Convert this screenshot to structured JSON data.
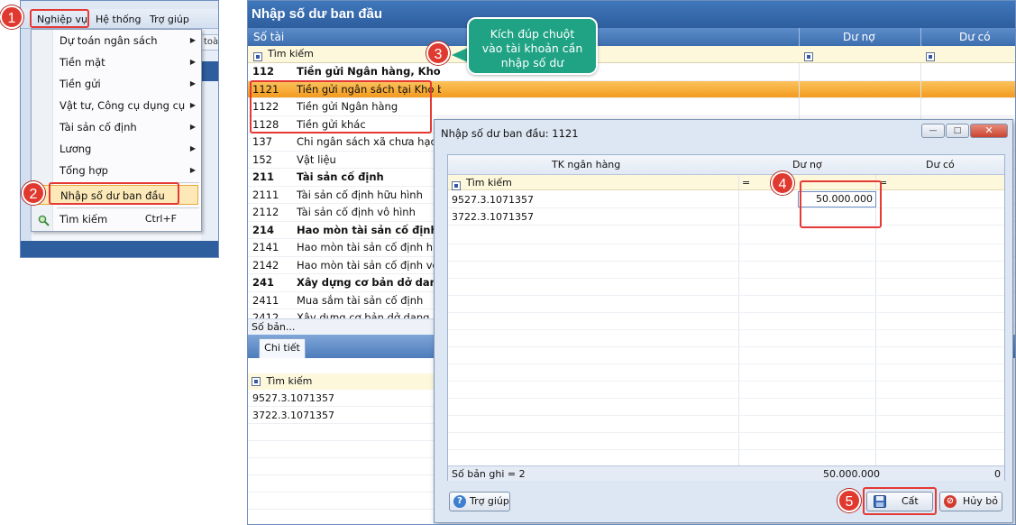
{
  "menu": {
    "menubar": [
      "Nghiệp vụ",
      "Hệ thống",
      "Trợ giúp"
    ],
    "items": [
      {
        "label": "Dự toán ngân sách",
        "submenu": true
      },
      {
        "label": "Tiền mặt",
        "submenu": true
      },
      {
        "label": "Tiền gửi",
        "submenu": true
      },
      {
        "label": "Vật tư, Công cụ dụng cụ",
        "submenu": true
      },
      {
        "label": "Tài sản cố định",
        "submenu": true
      },
      {
        "label": "Lương",
        "submenu": true
      },
      {
        "label": "Tổng hợp",
        "submenu": true
      },
      {
        "label": "Nhập số dư ban đầu",
        "submenu": false
      },
      {
        "label": "Tìm kiếm",
        "shortcut": "Ctrl+F",
        "submenu": false
      }
    ],
    "right_tab_fragment": "toà"
  },
  "steps": [
    "1",
    "2",
    "3",
    "4",
    "5"
  ],
  "main": {
    "title": "Nhập số dư ban đầu",
    "columns": {
      "account": "Số tài",
      "debit": "Dư nợ",
      "credit": "Dư có"
    },
    "search_label": "Tìm kiếm",
    "accounts": [
      {
        "code": "112",
        "name": "Tiền gửi Ngân hàng, Kho bạc",
        "bold": true
      },
      {
        "code": "1121",
        "name": "Tiền gửi ngân sách tại Kho bạc",
        "selected": true
      },
      {
        "code": "1122",
        "name": "Tiền gửi Ngân hàng"
      },
      {
        "code": "1128",
        "name": "Tiền gửi khác"
      },
      {
        "code": "137",
        "name": "Chi ngân sách xã chưa hạch toán"
      },
      {
        "code": "152",
        "name": "Vật liệu"
      },
      {
        "code": "211",
        "name": "Tài sản cố định",
        "bold": true
      },
      {
        "code": "2111",
        "name": "Tài sản cố định hữu hình"
      },
      {
        "code": "2112",
        "name": "Tài sản cố định vô hình"
      },
      {
        "code": "214",
        "name": "Hao mòn tài sản cố định",
        "bold": true
      },
      {
        "code": "2141",
        "name": "Hao mòn tài sản cố định hữu hình"
      },
      {
        "code": "2142",
        "name": "Hao mòn tài sản cố định vô hình"
      },
      {
        "code": "241",
        "name": "Xây dựng cơ bản dở dang",
        "bold": true
      },
      {
        "code": "2411",
        "name": "Mua sắm tài sản cố định"
      },
      {
        "code": "2412",
        "name": "Xây dựng cơ bản dở dang"
      }
    ],
    "footer": "Số bản...",
    "detail_tab": "Chi tiết",
    "detail_search": "Tìm kiếm",
    "detail_rows": [
      "9527.3.1071357",
      "3722.3.1071357"
    ]
  },
  "tooltip": {
    "line1": "Kích đúp chuột",
    "line2": "vào tài khoản cần",
    "line3": "nhập số dư"
  },
  "dialog": {
    "title": "Nhập số dư ban đầu: 1121",
    "columns": {
      "bank": "TK ngân hàng",
      "debit": "Dư nợ",
      "credit": "Dư có"
    },
    "search_label": "Tìm kiếm",
    "filter_op": "=",
    "rows": [
      {
        "bank": "9527.3.1071357",
        "debit": "50.000.000",
        "credit": ""
      },
      {
        "bank": "3722.3.1071357",
        "debit": "",
        "credit": ""
      }
    ],
    "summary": {
      "label": "Số bản ghi = 2",
      "debit_total": "50.000.000",
      "credit_total": "0"
    },
    "buttons": {
      "help": "Trợ giúp",
      "save": "Cất",
      "cancel": "Hủy bỏ"
    }
  }
}
